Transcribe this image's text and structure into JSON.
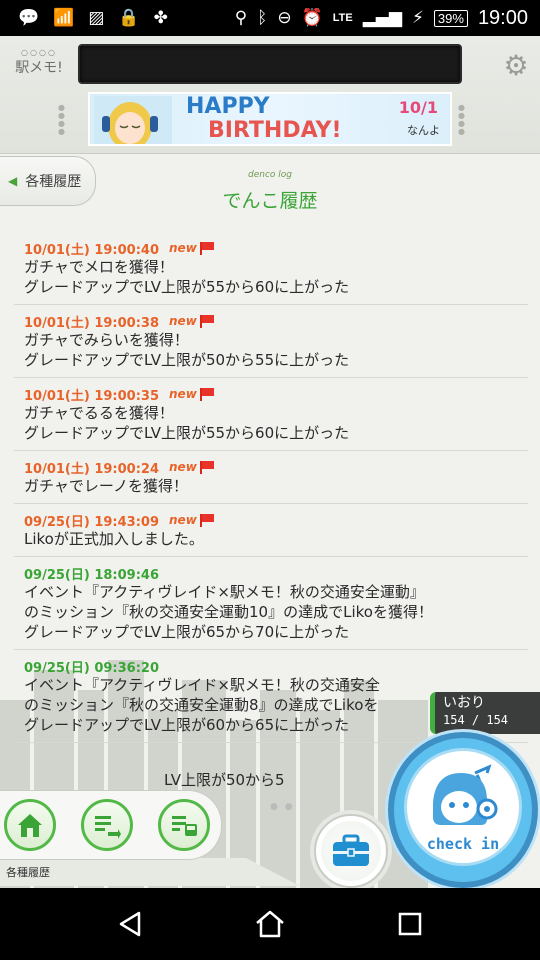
{
  "status_bar": {
    "time": "19:00",
    "battery": "39%",
    "network": "LTE"
  },
  "header": {
    "logo_text": "駅メモ!",
    "banner": {
      "line1": "HAPPY",
      "line2": "BIRTHDAY!",
      "date": "10/1",
      "suffix": "なんよ"
    }
  },
  "page": {
    "back_label": "各種履歴",
    "subtitle": "denco log",
    "title": "でんこ履歴"
  },
  "log": [
    {
      "date": "10/01(土) 19:00:40",
      "is_new": true,
      "lines": [
        "ガチャでメロを獲得！",
        "グレードアップでLV上限が55から60に上がった"
      ]
    },
    {
      "date": "10/01(土) 19:00:38",
      "is_new": true,
      "lines": [
        "ガチャでみらいを獲得！",
        "グレードアップでLV上限が50から55に上がった"
      ]
    },
    {
      "date": "10/01(土) 19:00:35",
      "is_new": true,
      "lines": [
        "ガチャでるるを獲得！",
        "グレードアップでLV上限が55から60に上がった"
      ]
    },
    {
      "date": "10/01(土) 19:00:24",
      "is_new": true,
      "lines": [
        "ガチャでレーノを獲得！"
      ]
    },
    {
      "date": "09/25(日) 19:43:09",
      "is_new": true,
      "lines": [
        "Likoが正式加入しました。"
      ]
    },
    {
      "date": "09/25(日) 18:09:46",
      "is_new": false,
      "lines": [
        "イベント『アクティヴレイド×駅メモ！秋の交通安全運動』",
        "のミッション『秋の交通安全運動10』の達成でLikoを獲得！",
        "グレードアップでLV上限が65から70に上がった"
      ]
    },
    {
      "date": "09/25(日) 09:36:20",
      "is_new": false,
      "lines": [
        "イベント『アクティヴレイド×駅メモ！秋の交通安全",
        "のミッション『秋の交通安全運動8』の達成でLikoを",
        "グレードアップでLV上限が60から65に上がった"
      ]
    },
    {
      "date": "",
      "is_new": false,
      "lines": [
        "",
        "LV上限が50から5"
      ]
    }
  ],
  "new_label": "new",
  "denco_status": {
    "name": "いおり",
    "hp": "154 / 154"
  },
  "footer": {
    "label": "各種履歴",
    "checkin_label": "check in"
  },
  "colors": {
    "accent_green": "#3aa536",
    "new_orange": "#e8632a",
    "checkin_blue": "#5dc0ee"
  }
}
